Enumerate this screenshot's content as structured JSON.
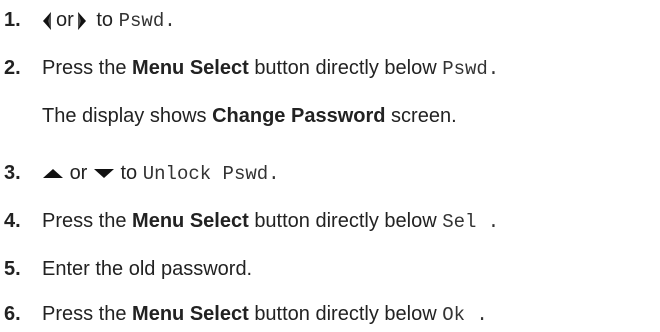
{
  "steps": [
    {
      "num": "1.",
      "left_icon": "triangle-left-icon",
      "or": "or",
      "right_icon": "triangle-right-icon",
      "to": "to",
      "code": "Pswd."
    },
    {
      "num": "2.",
      "press": "Press the",
      "bold": "Menu Select",
      "rest": "button directly below",
      "code": "Pswd."
    },
    {
      "sub_pre": "The display shows",
      "sub_bold": "Change Password",
      "sub_post": "screen."
    },
    {
      "num": "3.",
      "up_icon": "triangle-up-icon",
      "or": "or",
      "down_icon": "triangle-down-icon",
      "to": "to",
      "code": "Unlock Pswd."
    },
    {
      "num": "4.",
      "press": "Press the",
      "bold": "Menu Select",
      "rest": "button directly below",
      "code": "Sel ."
    },
    {
      "num": "5.",
      "text": "Enter the old password."
    },
    {
      "num": "6.",
      "press": "Press the",
      "bold": "Menu Select",
      "rest": "button directly below",
      "code": "Ok ."
    }
  ]
}
